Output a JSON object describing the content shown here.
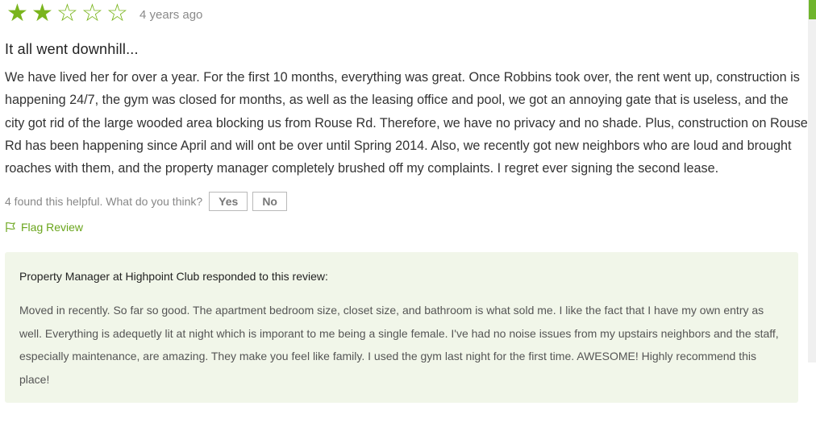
{
  "review": {
    "rating": 2,
    "rating_max": 5,
    "age": "4 years ago",
    "title": "It all went downhill...",
    "body": "We have lived her for over a year. For the first 10 months, everything was great. Once Robbins took over, the rent went up, construction is happening 24/7, the gym was closed for months, as well as the leasing office and pool, we got an annoying gate that is useless, and the city got rid of the large wooded area blocking us from Rouse Rd. Therefore, we have no privacy and no shade. Plus, construction on Rouse Rd has been happening since April and will ont be over until Spring 2014. Also, we recently got new neighbors who are loud and brought roaches with them, and the property manager completely brushed off my complaints. I regret ever signing the second lease.",
    "helpful_text": "4 found this helpful. What do you think?",
    "yes_label": "Yes",
    "no_label": "No",
    "flag_label": "Flag Review"
  },
  "response": {
    "heading": "Property Manager at Highpoint Club responded to this review:",
    "body": "Moved in recently. So far so good. The apartment bedroom size, closet size, and bathroom is what sold me. I like the fact that I have my own entry as well. Everything is adequetly lit at night which is imporant to me being a single female. I've had no noise issues from my upstairs neighbors and the staff, especially maintenance, are amazing. They make you feel like family. I used the gym last night for the first time. AWESOME! Highly recommend this place!"
  },
  "colors": {
    "accent": "#7ab51d",
    "response_bg": "#f1f6e9"
  },
  "icons": {
    "star_full": "star-filled-icon",
    "star_empty": "star-outline-icon",
    "flag": "flag-icon"
  }
}
